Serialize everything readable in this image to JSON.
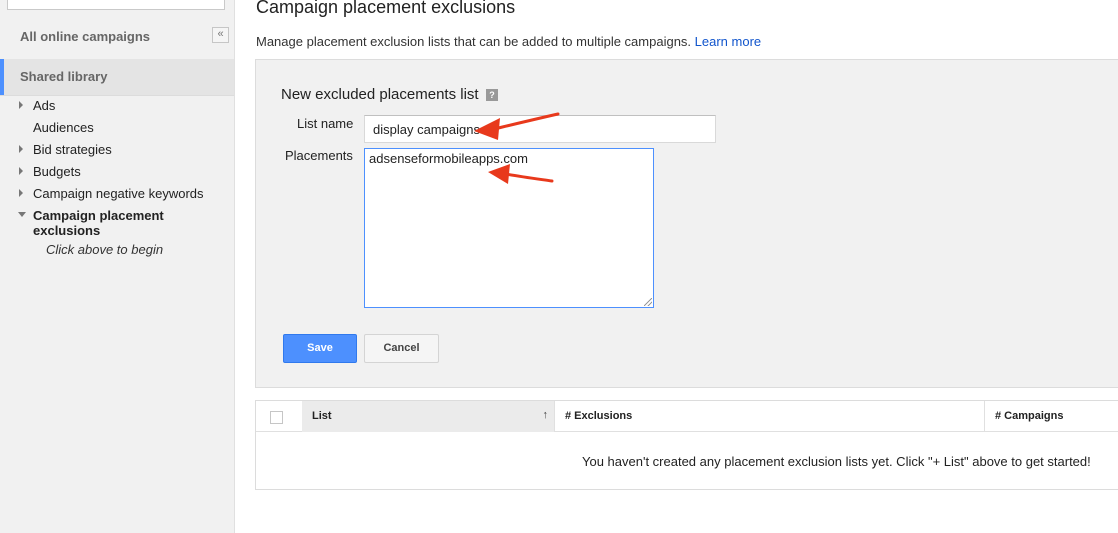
{
  "sidebar": {
    "all_campaigns": "All online campaigns",
    "collapse_glyph": "«",
    "shared_library": "Shared library",
    "items": [
      {
        "label": "Ads",
        "expandable": true
      },
      {
        "label": "Audiences",
        "expandable": false
      },
      {
        "label": "Bid strategies",
        "expandable": true
      },
      {
        "label": "Budgets",
        "expandable": true
      },
      {
        "label": "Campaign negative keywords",
        "expandable": true
      },
      {
        "label": "Campaign placement exclusions",
        "expandable": true,
        "expanded": true,
        "active": true
      }
    ],
    "hint": "Click above to begin"
  },
  "main": {
    "title": "Campaign placement exclusions",
    "description": "Manage placement exclusion lists that can be added to multiple campaigns.",
    "learn_more": "Learn more"
  },
  "form": {
    "title": "New excluded placements list",
    "help_icon": "?",
    "list_name_label": "List name",
    "list_name_value": "display campaigns",
    "placements_label": "Placements",
    "placements_value": "adsenseformobileapps.com",
    "save_label": "Save",
    "cancel_label": "Cancel"
  },
  "table": {
    "columns": [
      "List",
      "# Exclusions",
      "# Campaigns"
    ],
    "sort_glyph": "↑",
    "empty_message": "You haven't created any placement exclusion lists yet. Click \"+ List\" above to get started!"
  },
  "colors": {
    "accent": "#4d90fe",
    "annotation": "#e8391c",
    "link": "#1155cc"
  }
}
